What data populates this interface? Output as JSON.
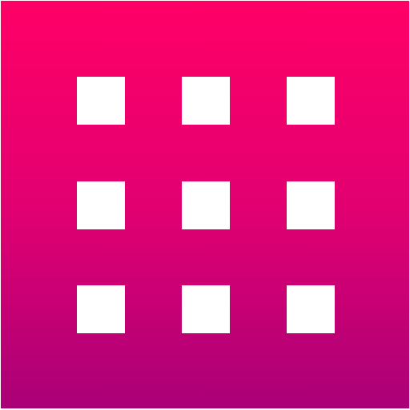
{
  "icon": {
    "name": "grid-icon",
    "gradient_top_color": "#ff0066",
    "gradient_bottom_color": "#aa0077",
    "square_color": "#ffffff",
    "grid": {
      "rows": 3,
      "cols": 3
    }
  }
}
